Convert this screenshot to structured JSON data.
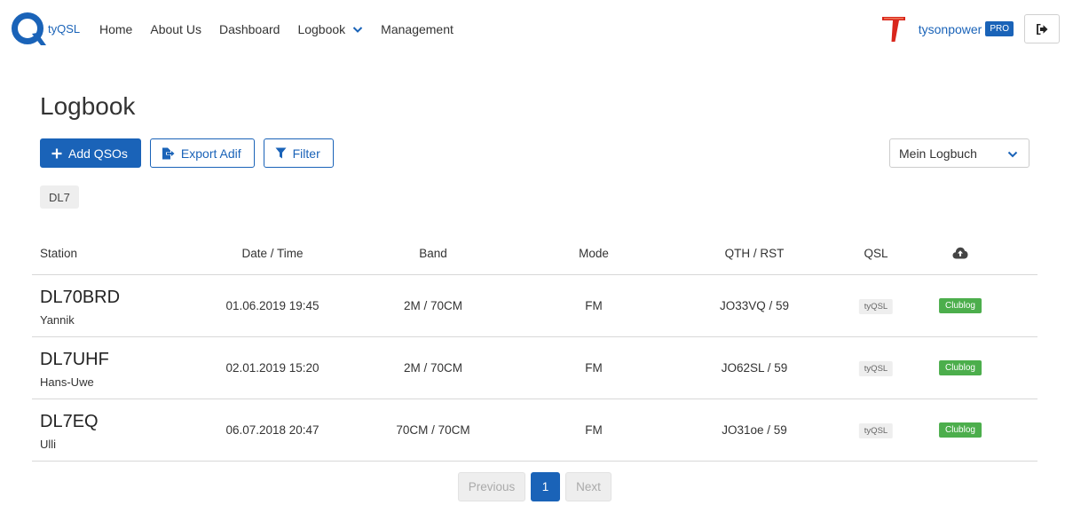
{
  "brand": {
    "name": "tyQSL"
  },
  "nav": {
    "items": [
      {
        "label": "Home"
      },
      {
        "label": "About Us"
      },
      {
        "label": "Dashboard"
      },
      {
        "label": "Logbook"
      },
      {
        "label": "Management"
      }
    ]
  },
  "user": {
    "name": "tysonpower",
    "badge": "PRO"
  },
  "page": {
    "title": "Logbook"
  },
  "toolbar": {
    "add_label": "Add QSOs",
    "export_label": "Export Adif",
    "filter_label": "Filter",
    "logbook_select": "Mein Logbuch"
  },
  "active_filter": "DL7",
  "table": {
    "headers": {
      "station": "Station",
      "datetime": "Date / Time",
      "band": "Band",
      "mode": "Mode",
      "qth": "QTH / RST",
      "qsl": "QSL"
    },
    "rows": [
      {
        "callsign": "DL70BRD",
        "name": "Yannik",
        "datetime": "01.06.2019 19:45",
        "band": "2M / 70CM",
        "mode": "FM",
        "qth": "JO33VQ / 59",
        "qsl": "tyQSL",
        "upload": "Clublog"
      },
      {
        "callsign": "DL7UHF",
        "name": "Hans-Uwe",
        "datetime": "02.01.2019 15:20",
        "band": "2M / 70CM",
        "mode": "FM",
        "qth": "JO62SL / 59",
        "qsl": "tyQSL",
        "upload": "Clublog"
      },
      {
        "callsign": "DL7EQ",
        "name": "Ulli",
        "datetime": "06.07.2018 20:47",
        "band": "70CM / 70CM",
        "mode": "FM",
        "qth": "JO31oe / 59",
        "qsl": "tyQSL",
        "upload": "Clublog"
      }
    ]
  },
  "pagination": {
    "previous": "Previous",
    "current": "1",
    "next": "Next"
  },
  "colors": {
    "primary": "#1a63b8",
    "success": "#4cae4c",
    "avatar": "#d9261c"
  }
}
